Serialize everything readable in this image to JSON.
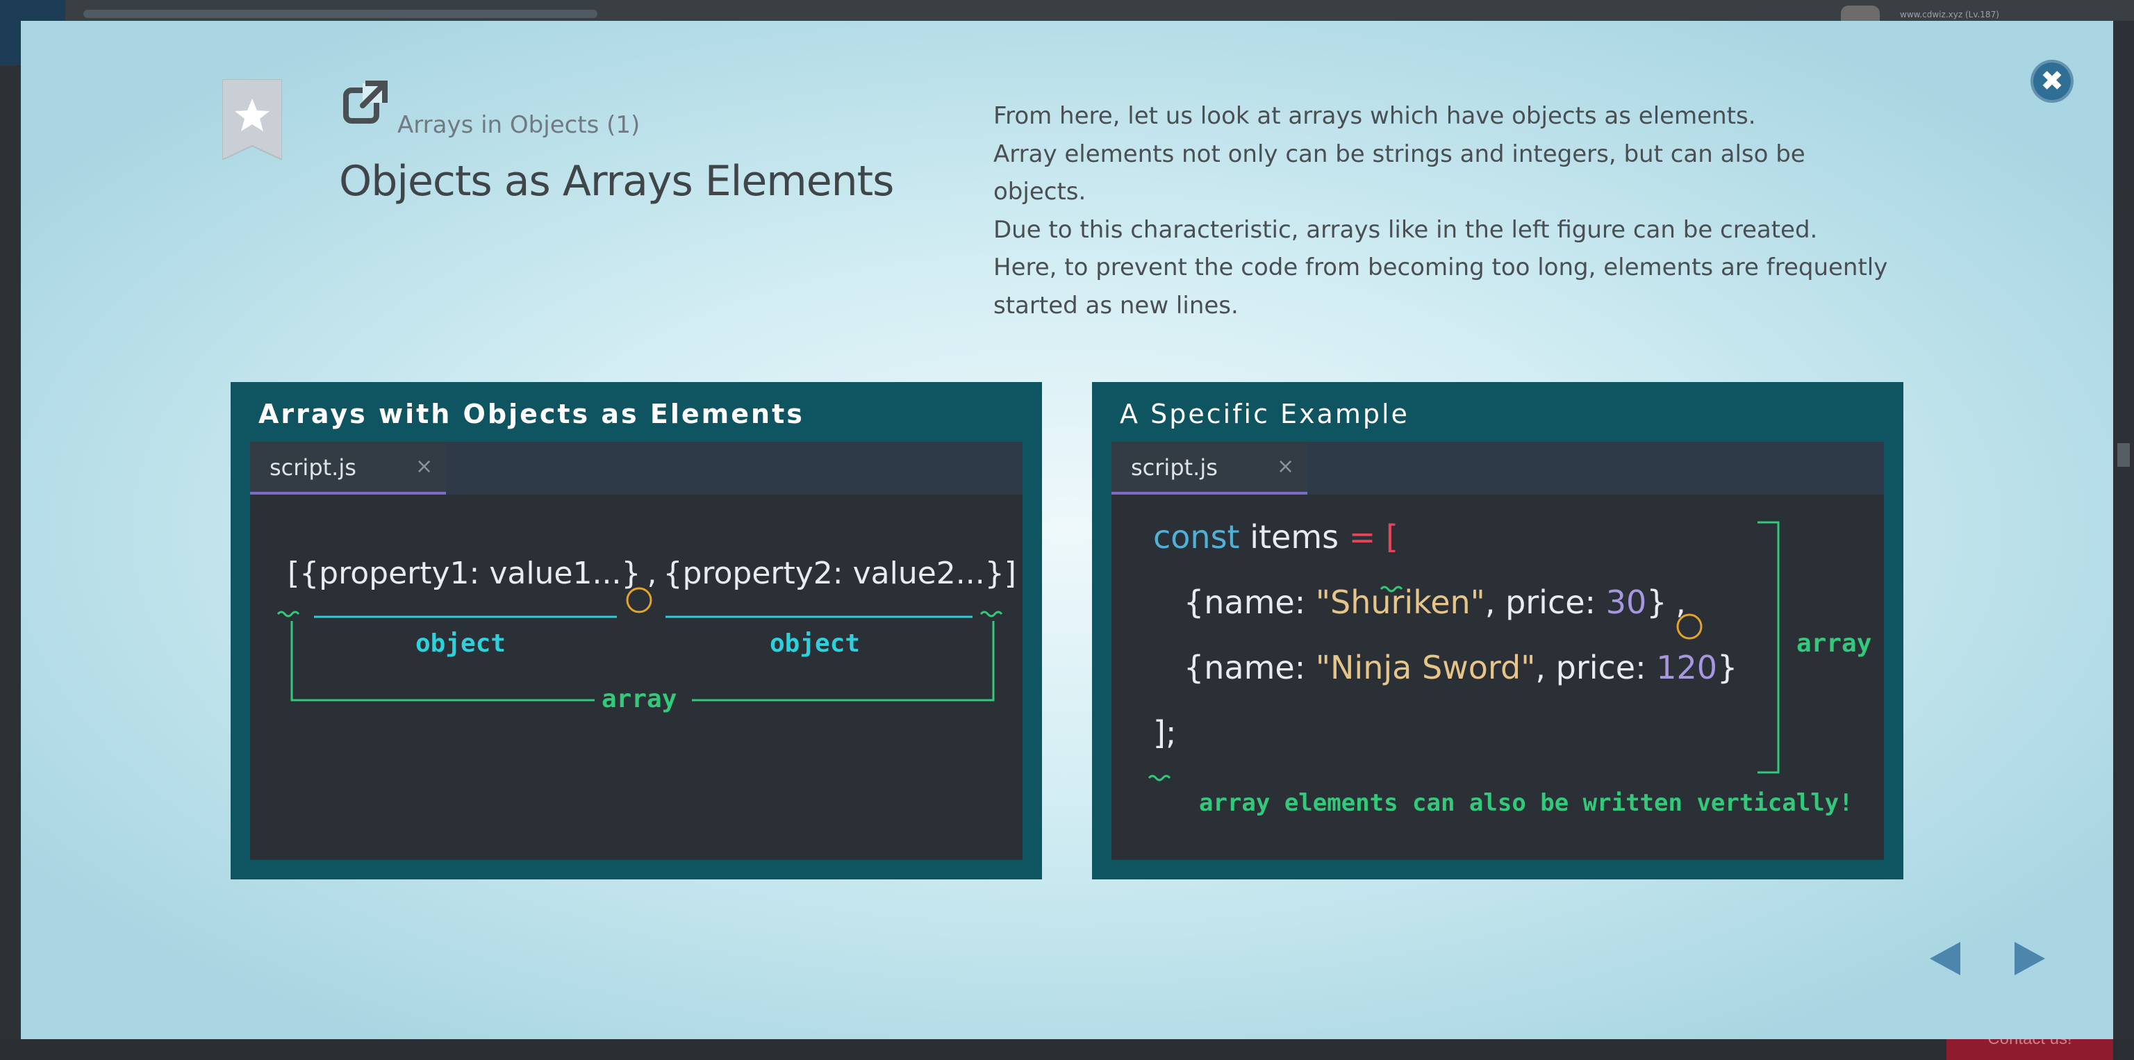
{
  "background": {
    "user_text": "www.cdwiz.xyz (Lv.187)",
    "contact_label": "Contact us!"
  },
  "lesson": {
    "subtitle": "Arrays in Objects (1)",
    "title": "Objects as Arrays Elements",
    "description": [
      "From here, let us look at arrays which have objects as elements.",
      "Array elements not only can be strings and integers, but can also be objects.",
      "Due to this characteristic, arrays like in the left figure can be created.",
      "Here, to prevent the code from becoming too long, elements are frequently started as new lines."
    ]
  },
  "slide_left": {
    "heading": "Arrays with Objects as Elements",
    "tab": "script.js",
    "tab_close": "×",
    "code_part1": "[{property1: value1...}",
    "code_comma": ",",
    "code_part2": "{property2: value2...}]",
    "label_object_1": "object",
    "label_object_2": "object",
    "label_array": "array"
  },
  "slide_right": {
    "heading": "A Specific Example",
    "tab": "script.js",
    "tab_close": "×",
    "line1_kw": "const",
    "line1_name": " items ",
    "line1_eq": "=",
    "line1_bracket": " [",
    "line2_a": "{name: ",
    "line2_str": "\"Shuriken\"",
    "line2_b": ", price: ",
    "line2_num": "30",
    "line2_c": "}",
    "line2_comma": ",",
    "line3_a": "{name: ",
    "line3_str": "\"Ninja Sword\"",
    "line3_b": ", price: ",
    "line3_num": "120",
    "line3_c": "}",
    "line4": "];",
    "label_array": "array",
    "note": "array elements can also be written vertically!"
  },
  "icons": {
    "close": "close-icon",
    "bookmark": "bookmark-star-icon",
    "external": "external-link-icon",
    "prev": "prev-arrow-icon",
    "next": "next-arrow-icon"
  },
  "colors": {
    "accent_blue": "#2f6f95",
    "slide_bg": "#0f5461",
    "editor_bg": "#2b2f36",
    "label_cyan": "#2ed0dc",
    "label_green": "#32c97a",
    "comma_circle": "#e0a52a"
  }
}
